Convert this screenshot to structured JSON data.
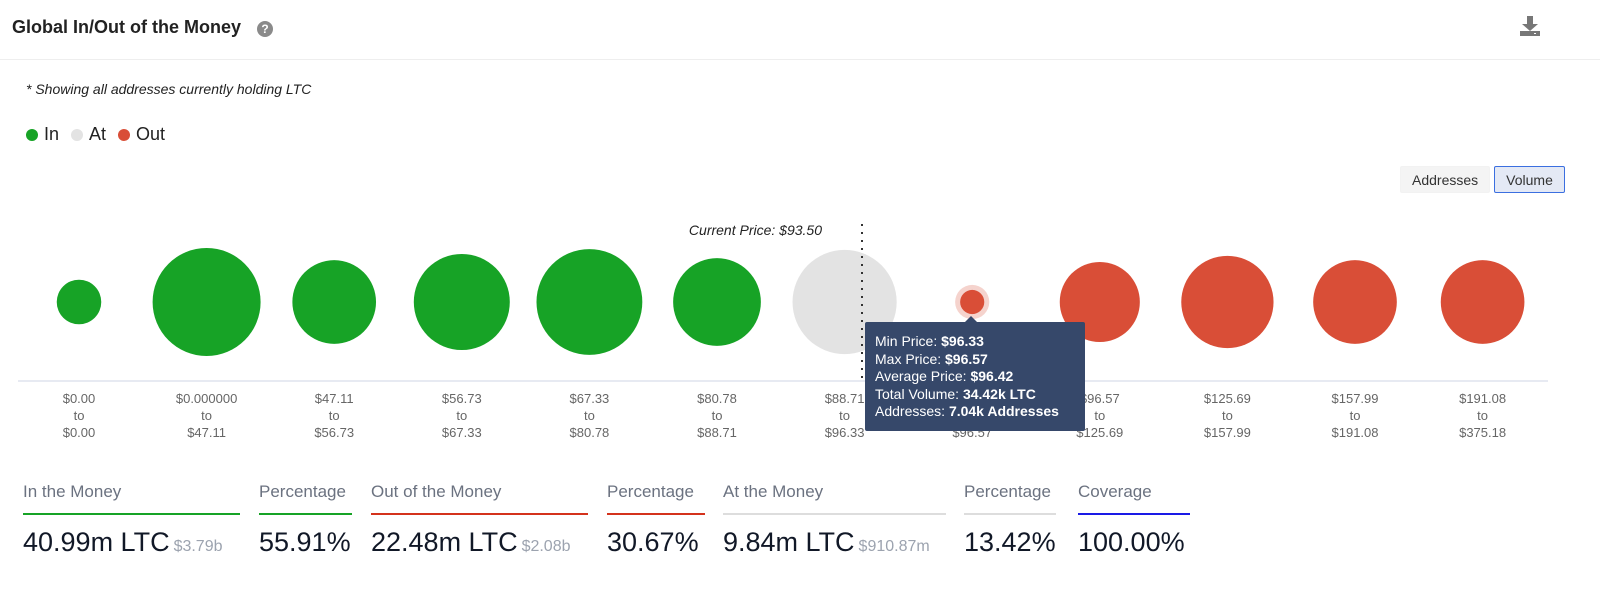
{
  "header": {
    "title": "Global In/Out of the Money",
    "help_icon": "question-circle-icon",
    "download_icon": "download-icon"
  },
  "note": "* Showing all addresses currently holding LTC",
  "legend": [
    {
      "label": "In",
      "color": "#17a326"
    },
    {
      "label": "At",
      "color": "#e3e3e3"
    },
    {
      "label": "Out",
      "color": "#d94e37"
    }
  ],
  "toggle": {
    "options": [
      "Addresses",
      "Volume"
    ],
    "selected": "Volume"
  },
  "chart_data": {
    "type": "bubble",
    "current_price_label": "Current Price: $93.50",
    "current_price": 93.5,
    "connector": "to",
    "buckets": [
      {
        "min": "$0.00",
        "max": "$0.00",
        "status": "In",
        "relative_size": 0.17
      },
      {
        "min": "$0.000000",
        "max": "$47.11",
        "status": "In",
        "relative_size": 1.0
      },
      {
        "min": "$47.11",
        "max": "$56.73",
        "status": "In",
        "relative_size": 0.6
      },
      {
        "min": "$56.73",
        "max": "$67.33",
        "status": "In",
        "relative_size": 0.79
      },
      {
        "min": "$67.33",
        "max": "$80.78",
        "status": "In",
        "relative_size": 0.96
      },
      {
        "min": "$80.78",
        "max": "$88.71",
        "status": "In",
        "relative_size": 0.66
      },
      {
        "min": "$88.71",
        "max": "$96.33",
        "status": "At",
        "relative_size": 0.93
      },
      {
        "min": "$96.33",
        "max": "$96.57",
        "status": "Out",
        "relative_size": 0.05,
        "highlighted": true
      },
      {
        "min": "$96.57",
        "max": "$125.69",
        "status": "Out",
        "relative_size": 0.55
      },
      {
        "min": "$125.69",
        "max": "$157.99",
        "status": "Out",
        "relative_size": 0.73
      },
      {
        "min": "$157.99",
        "max": "$191.08",
        "status": "Out",
        "relative_size": 0.6
      },
      {
        "min": "$191.08",
        "max": "$375.18",
        "status": "Out",
        "relative_size": 0.6
      }
    ]
  },
  "tooltip": {
    "rows": [
      {
        "label": "Min Price: ",
        "value": "$96.33"
      },
      {
        "label": "Max Price: ",
        "value": "$96.57"
      },
      {
        "label": "Average Price: ",
        "value": "$96.42"
      },
      {
        "label": "Total Volume: ",
        "value": "34.42k LTC"
      },
      {
        "label": "Addresses: ",
        "value": "7.04k Addresses"
      }
    ]
  },
  "stats": [
    {
      "label": "In the Money",
      "value": "40.99m LTC",
      "sub": "$3.79b",
      "color": "#17a326"
    },
    {
      "label": "Percentage",
      "value": "55.91%",
      "color": "#17a326"
    },
    {
      "label": "Out of the Money",
      "value": "22.48m LTC",
      "sub": "$2.08b",
      "color": "#d4321c"
    },
    {
      "label": "Percentage",
      "value": "30.67%",
      "color": "#d4321c"
    },
    {
      "label": "At the Money",
      "value": "9.84m LTC",
      "sub": "$910.87m",
      "color": "#dddddd"
    },
    {
      "label": "Percentage",
      "value": "13.42%",
      "color": "#dddddd"
    },
    {
      "label": "Coverage",
      "value": "100.00%",
      "color": "#1a1ae6"
    }
  ]
}
